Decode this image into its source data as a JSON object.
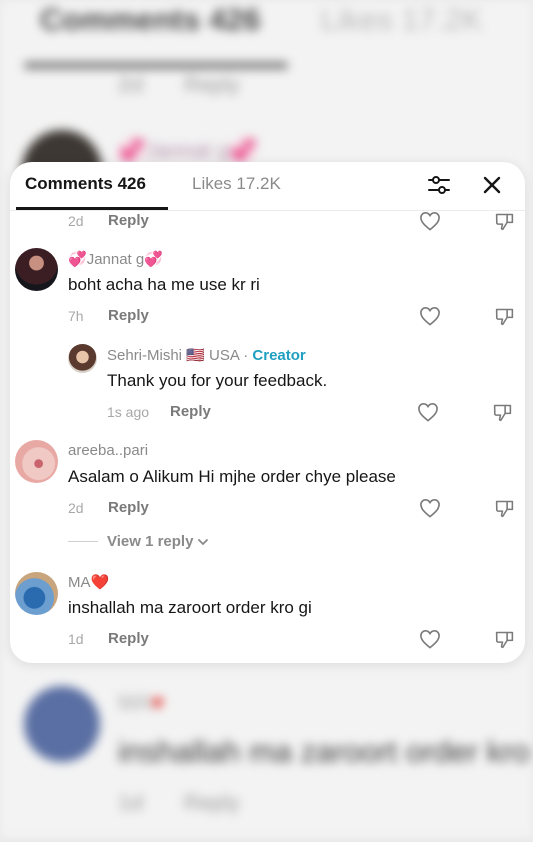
{
  "background": {
    "tab_comments": "Comments 426",
    "tab_likes": "Likes 17.2K",
    "top_meta_time": "2d",
    "top_meta_reply": "Reply",
    "top_comment_name": "Jannat g",
    "bottom_comment_name": "MA",
    "bottom_comment_text": "inshallah ma zaroort order kro",
    "bottom_meta_time": "1d",
    "bottom_meta_reply": "Reply"
  },
  "sheet": {
    "tabs": {
      "comments": "Comments 426",
      "likes": "Likes 17.2K"
    },
    "filter_icon": "sliders-icon",
    "close_icon": "close-icon",
    "colors": {
      "primary_text": "#161616",
      "secondary_text": "#8a8a8a",
      "creator_accent": "#1fa0c0",
      "flag_heart": "#e0302a"
    }
  },
  "comments": [
    {
      "id": "partial-top",
      "time": "2d",
      "reply_label": "Reply"
    },
    {
      "id": "jannat",
      "name": "Jannat g",
      "name_emoji": "💞",
      "text": "boht acha ha me use kr ri",
      "time": "7h",
      "reply_label": "Reply"
    },
    {
      "id": "sehri-mishi",
      "name": "Sehri-Mishi",
      "flag": "🇺🇸",
      "country": "USA",
      "separator": "·",
      "badge": "Creator",
      "text": "Thank you for your feedback.",
      "time": "1s ago",
      "reply_label": "Reply"
    },
    {
      "id": "areeba",
      "name": "areeba..pari",
      "text": "Asalam o Alikum Hi mjhe order chye please",
      "time": "2d",
      "reply_label": "Reply",
      "view_replies": "View 1 reply"
    },
    {
      "id": "ma",
      "name": "MA",
      "name_emoji": "❤️",
      "text": "inshallah ma zaroort order kro gi",
      "time": "1d",
      "reply_label": "Reply"
    }
  ]
}
